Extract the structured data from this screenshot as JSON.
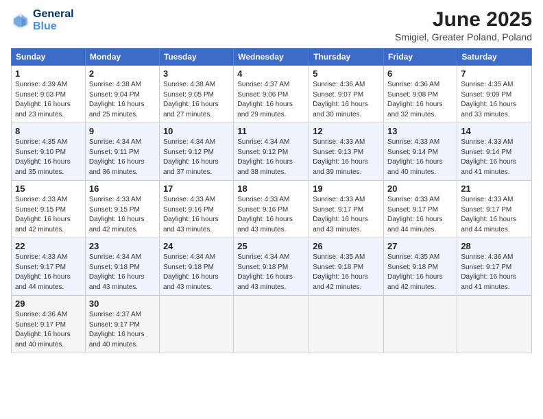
{
  "header": {
    "logo_general": "General",
    "logo_blue": "Blue",
    "month_year": "June 2025",
    "location": "Smigiel, Greater Poland, Poland"
  },
  "weekdays": [
    "Sunday",
    "Monday",
    "Tuesday",
    "Wednesday",
    "Thursday",
    "Friday",
    "Saturday"
  ],
  "weeks": [
    [
      {
        "day": "1",
        "sunrise": "4:39 AM",
        "sunset": "9:03 PM",
        "daylight": "16 hours and 23 minutes."
      },
      {
        "day": "2",
        "sunrise": "4:38 AM",
        "sunset": "9:04 PM",
        "daylight": "16 hours and 25 minutes."
      },
      {
        "day": "3",
        "sunrise": "4:38 AM",
        "sunset": "9:05 PM",
        "daylight": "16 hours and 27 minutes."
      },
      {
        "day": "4",
        "sunrise": "4:37 AM",
        "sunset": "9:06 PM",
        "daylight": "16 hours and 29 minutes."
      },
      {
        "day": "5",
        "sunrise": "4:36 AM",
        "sunset": "9:07 PM",
        "daylight": "16 hours and 30 minutes."
      },
      {
        "day": "6",
        "sunrise": "4:36 AM",
        "sunset": "9:08 PM",
        "daylight": "16 hours and 32 minutes."
      },
      {
        "day": "7",
        "sunrise": "4:35 AM",
        "sunset": "9:09 PM",
        "daylight": "16 hours and 33 minutes."
      }
    ],
    [
      {
        "day": "8",
        "sunrise": "4:35 AM",
        "sunset": "9:10 PM",
        "daylight": "16 hours and 35 minutes."
      },
      {
        "day": "9",
        "sunrise": "4:34 AM",
        "sunset": "9:11 PM",
        "daylight": "16 hours and 36 minutes."
      },
      {
        "day": "10",
        "sunrise": "4:34 AM",
        "sunset": "9:12 PM",
        "daylight": "16 hours and 37 minutes."
      },
      {
        "day": "11",
        "sunrise": "4:34 AM",
        "sunset": "9:12 PM",
        "daylight": "16 hours and 38 minutes."
      },
      {
        "day": "12",
        "sunrise": "4:33 AM",
        "sunset": "9:13 PM",
        "daylight": "16 hours and 39 minutes."
      },
      {
        "day": "13",
        "sunrise": "4:33 AM",
        "sunset": "9:14 PM",
        "daylight": "16 hours and 40 minutes."
      },
      {
        "day": "14",
        "sunrise": "4:33 AM",
        "sunset": "9:14 PM",
        "daylight": "16 hours and 41 minutes."
      }
    ],
    [
      {
        "day": "15",
        "sunrise": "4:33 AM",
        "sunset": "9:15 PM",
        "daylight": "16 hours and 42 minutes."
      },
      {
        "day": "16",
        "sunrise": "4:33 AM",
        "sunset": "9:15 PM",
        "daylight": "16 hours and 42 minutes."
      },
      {
        "day": "17",
        "sunrise": "4:33 AM",
        "sunset": "9:16 PM",
        "daylight": "16 hours and 43 minutes."
      },
      {
        "day": "18",
        "sunrise": "4:33 AM",
        "sunset": "9:16 PM",
        "daylight": "16 hours and 43 minutes."
      },
      {
        "day": "19",
        "sunrise": "4:33 AM",
        "sunset": "9:17 PM",
        "daylight": "16 hours and 43 minutes."
      },
      {
        "day": "20",
        "sunrise": "4:33 AM",
        "sunset": "9:17 PM",
        "daylight": "16 hours and 44 minutes."
      },
      {
        "day": "21",
        "sunrise": "4:33 AM",
        "sunset": "9:17 PM",
        "daylight": "16 hours and 44 minutes."
      }
    ],
    [
      {
        "day": "22",
        "sunrise": "4:33 AM",
        "sunset": "9:17 PM",
        "daylight": "16 hours and 44 minutes."
      },
      {
        "day": "23",
        "sunrise": "4:34 AM",
        "sunset": "9:18 PM",
        "daylight": "16 hours and 43 minutes."
      },
      {
        "day": "24",
        "sunrise": "4:34 AM",
        "sunset": "9:18 PM",
        "daylight": "16 hours and 43 minutes."
      },
      {
        "day": "25",
        "sunrise": "4:34 AM",
        "sunset": "9:18 PM",
        "daylight": "16 hours and 43 minutes."
      },
      {
        "day": "26",
        "sunrise": "4:35 AM",
        "sunset": "9:18 PM",
        "daylight": "16 hours and 42 minutes."
      },
      {
        "day": "27",
        "sunrise": "4:35 AM",
        "sunset": "9:18 PM",
        "daylight": "16 hours and 42 minutes."
      },
      {
        "day": "28",
        "sunrise": "4:36 AM",
        "sunset": "9:17 PM",
        "daylight": "16 hours and 41 minutes."
      }
    ],
    [
      {
        "day": "29",
        "sunrise": "4:36 AM",
        "sunset": "9:17 PM",
        "daylight": "16 hours and 40 minutes."
      },
      {
        "day": "30",
        "sunrise": "4:37 AM",
        "sunset": "9:17 PM",
        "daylight": "16 hours and 40 minutes."
      },
      null,
      null,
      null,
      null,
      null
    ]
  ]
}
